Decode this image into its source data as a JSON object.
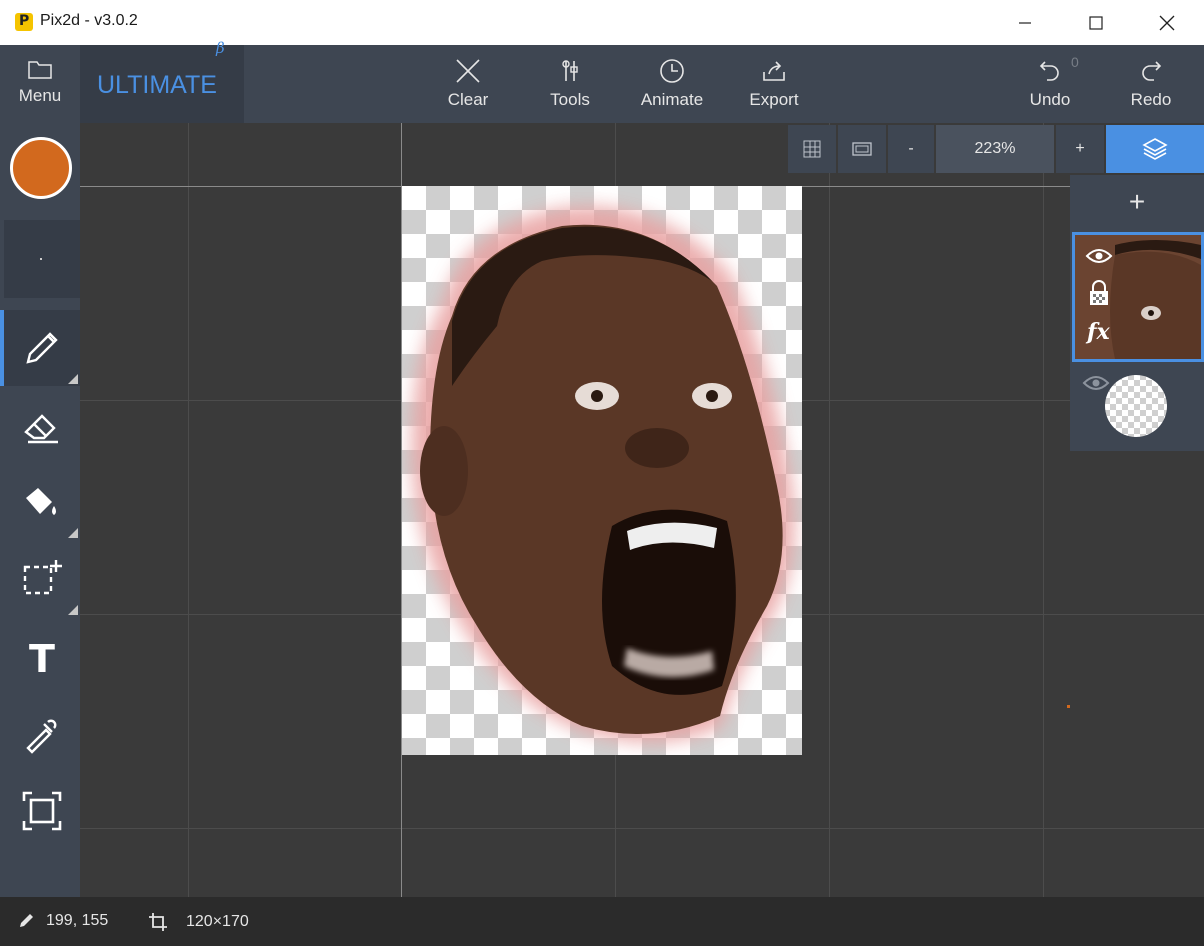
{
  "window": {
    "title": "Pix2d - v3.0.2"
  },
  "toolbar": {
    "menu_label": "Menu",
    "edition": "ULTIMATE",
    "edition_suffix": "β",
    "clear_label": "Clear",
    "tools_label": "Tools",
    "animate_label": "Animate",
    "export_label": "Export",
    "undo_label": "Undo",
    "undo_count": "0",
    "redo_label": "Redo"
  },
  "sidebar": {
    "primary_color": "#d2691e",
    "tools": [
      {
        "name": "pencil",
        "active": true
      },
      {
        "name": "eraser",
        "active": false
      },
      {
        "name": "fill",
        "active": false
      },
      {
        "name": "selection",
        "active": false
      },
      {
        "name": "text",
        "glyph": "T",
        "active": false
      },
      {
        "name": "eyedropper",
        "active": false
      },
      {
        "name": "crop",
        "active": false
      }
    ]
  },
  "zoom": {
    "minus_label": "-",
    "value": "223%",
    "plus_label": "+"
  },
  "layers": {
    "add_label": "+"
  },
  "status": {
    "cursor": "199, 155",
    "canvas_size": "120×170"
  },
  "colors": {
    "accent": "#4a90e2",
    "panel": "#3e4652",
    "canvas_bg": "#3a3a3a"
  }
}
